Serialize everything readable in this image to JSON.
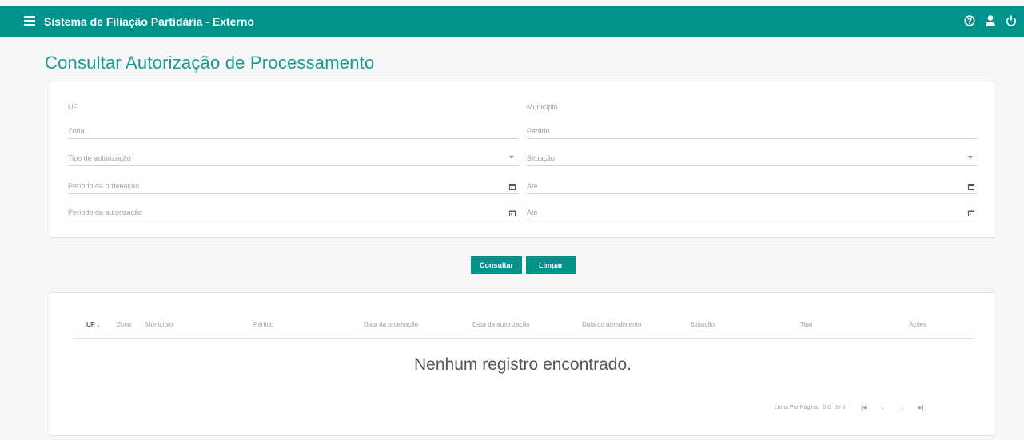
{
  "header": {
    "app_title": "Sistema de Filiação Partidária - Externo",
    "icons": [
      "menu-icon",
      "help-icon",
      "user-icon",
      "power-icon"
    ]
  },
  "page": {
    "title": "Consultar Autorização de Processamento"
  },
  "filters": {
    "uf": "UF",
    "municipio": "Município",
    "zona": "Zona",
    "partido": "Partido",
    "tipo_autorizacao": "Tipo de autorização",
    "situacao": "Situação",
    "periodo_ordenacao": "Período da ordenação",
    "ate_ordenacao": "Até",
    "periodo_autorizacao": "Período da autorização",
    "ate_autorizacao": "Até"
  },
  "actions": {
    "consultar": "Consultar",
    "limpar": "Limpar"
  },
  "table": {
    "columns": [
      "UF",
      "Zona",
      "Município",
      "Partido",
      "Data da ordenação",
      "Data da autorização",
      "Data do atendimento",
      "Situação",
      "Tipo",
      "Ações"
    ],
    "sort_indicator": "↓",
    "empty_message": "Nenhum registro encontrado."
  },
  "pagination": {
    "rows_label": "Linha Por Página:",
    "range": "0-0",
    "of_label": "de 0",
    "first": "|◂",
    "prev": "‹",
    "next": "›",
    "last": "▸|"
  },
  "colors": {
    "primary": "#00928b",
    "title": "#1b9a93"
  }
}
